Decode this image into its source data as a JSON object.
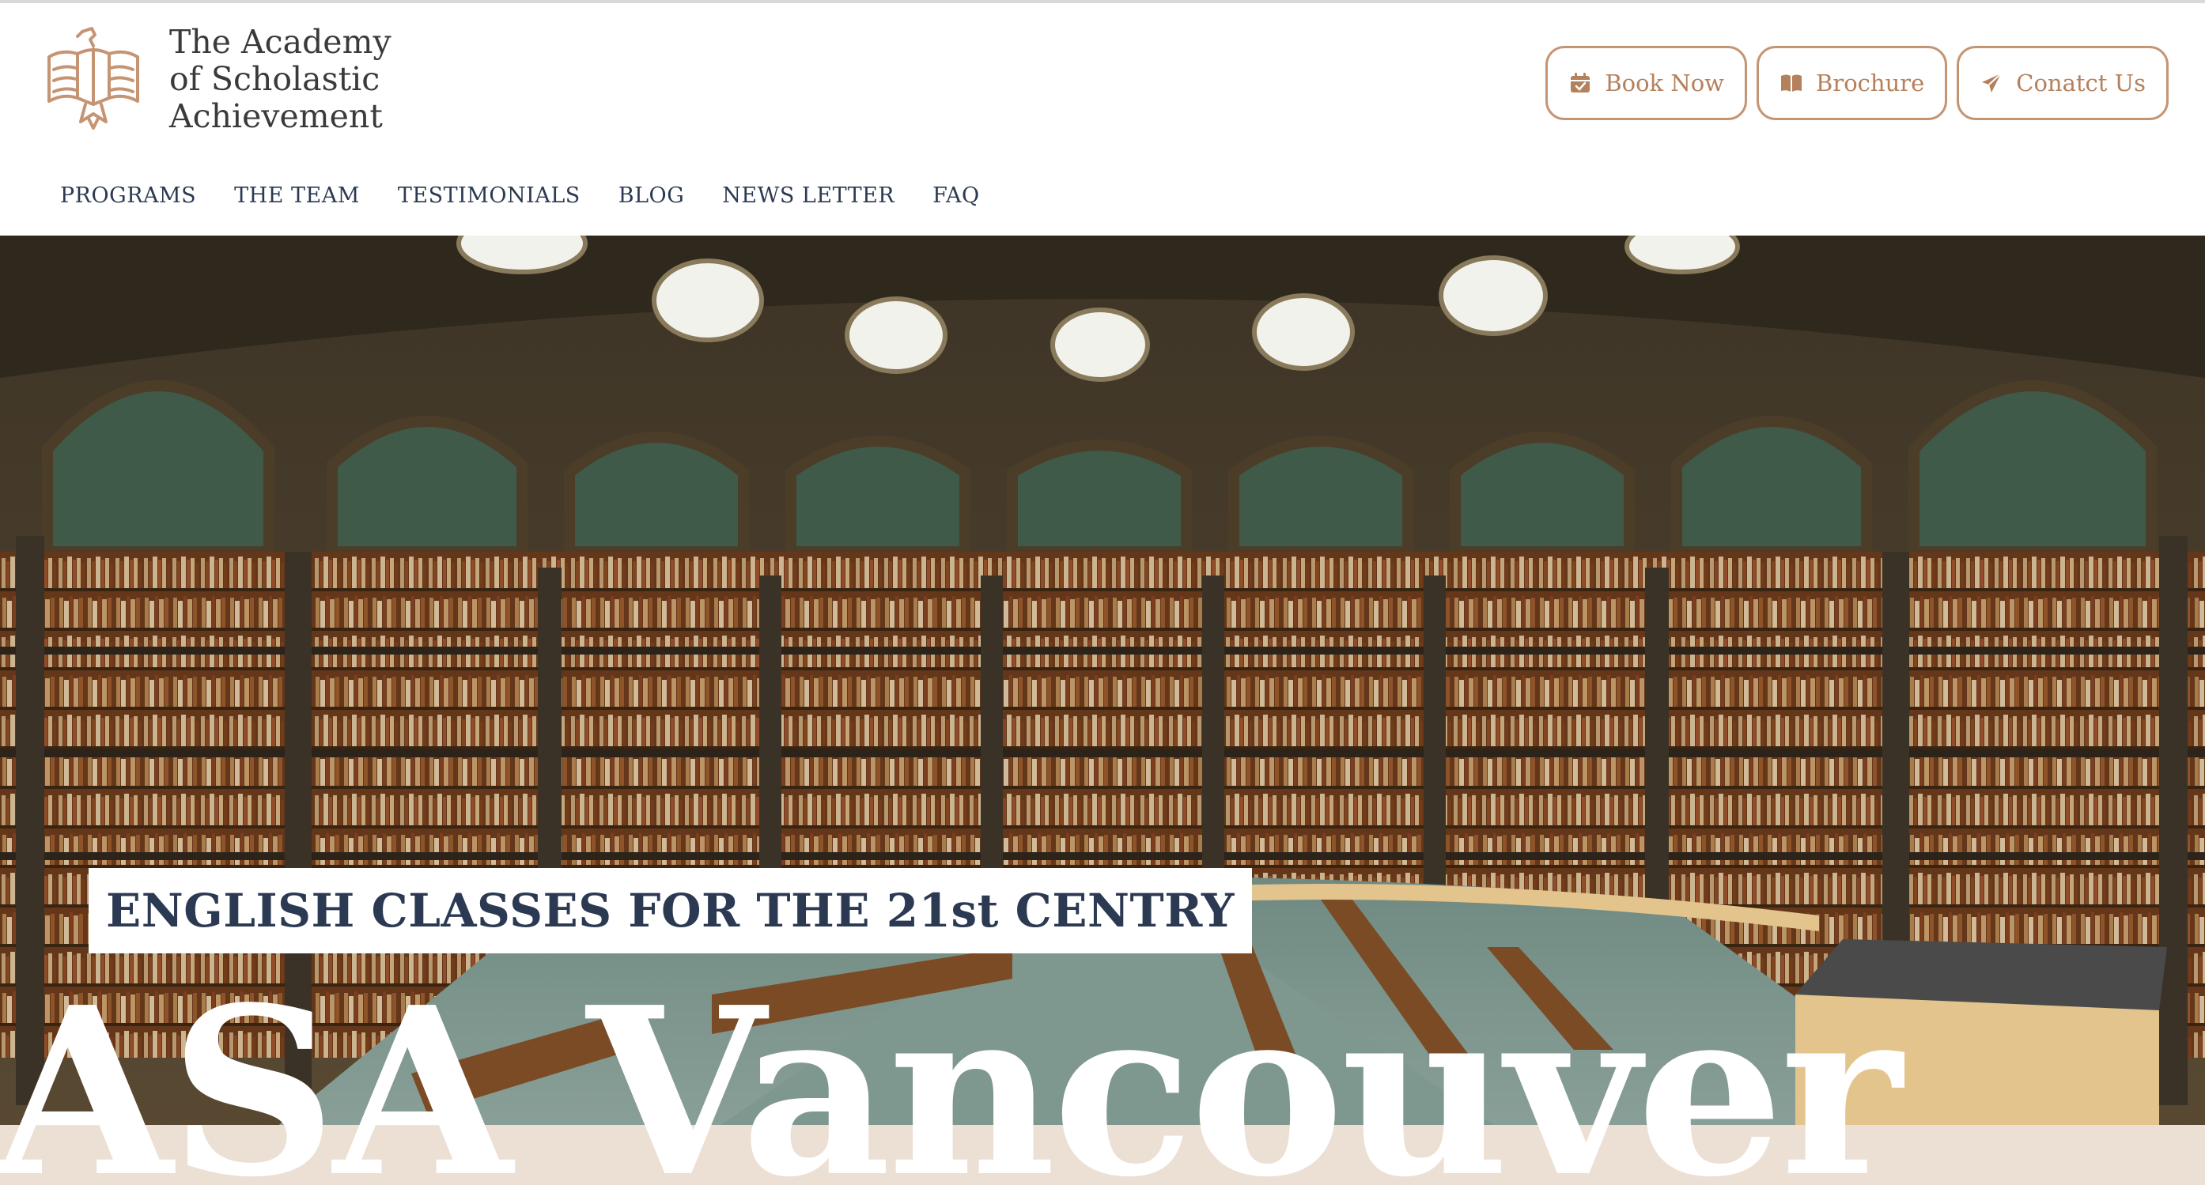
{
  "brand": {
    "logo_lines": [
      "The Academy",
      "of Scholastic",
      "Achievement"
    ],
    "logo_icon": "eagle-book-icon",
    "accent_color": "#c59573",
    "text_color": "#2b3a52"
  },
  "actions": [
    {
      "label": "Book Now",
      "icon": "calendar-icon"
    },
    {
      "label": "Brochure",
      "icon": "book-open-icon"
    },
    {
      "label": "Conatct Us",
      "icon": "paper-plane-icon"
    }
  ],
  "nav": [
    "PROGRAMS",
    "THE TEAM",
    "TESTIMONIALS",
    "BLOG",
    "NEWS LETTER",
    "FAQ"
  ],
  "hero": {
    "tagline": "ENGLISH CLASSES FOR THE 21st CENTRY",
    "title": "ASA Vancouver",
    "image": "library-reading-room-photo"
  }
}
